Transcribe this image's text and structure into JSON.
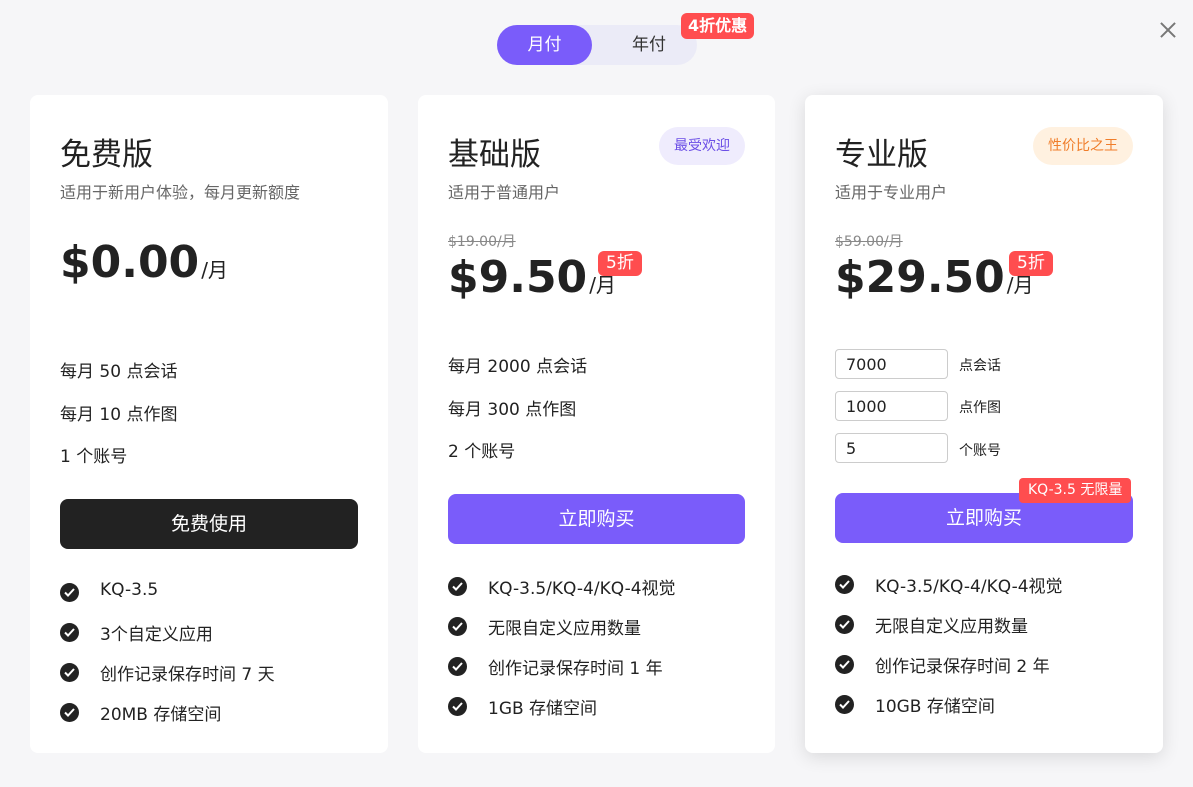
{
  "toggle": {
    "monthly": "月付",
    "yearly": "年付",
    "yearly_discount": "4折优惠"
  },
  "plans": {
    "free": {
      "title": "免费版",
      "subtitle": "适用于新用户体验，每月更新额度",
      "price": "$0.00",
      "unit": "/月",
      "quotas": [
        "每月 50 点会话",
        "每月 10 点作图",
        "1 个账号"
      ],
      "button": "免费使用",
      "features": [
        "KQ-3.5",
        "3个自定义应用",
        "创作记录保存时间 7 天",
        "20MB 存储空间"
      ]
    },
    "basic": {
      "title": "基础版",
      "badge": "最受欢迎",
      "subtitle": "适用于普通用户",
      "old_price": "$19.00/月",
      "price": "$9.50",
      "unit": "/月",
      "off": "5折",
      "quotas": [
        "每月 2000 点会话",
        "每月 300 点作图",
        "2 个账号"
      ],
      "button": "立即购买",
      "features": [
        " KQ-3.5/KQ-4/KQ-4视觉",
        "无限自定义应用数量",
        "创作记录保存时间 1 年",
        "1GB 存储空间"
      ]
    },
    "pro": {
      "title": "专业版",
      "badge": "性价比之王",
      "subtitle": "适用于专业用户",
      "old_price": "$59.00/月",
      "price": "$29.50",
      "unit": "/月",
      "off": "5折",
      "inputs": [
        {
          "value": "7000",
          "label": "点会话"
        },
        {
          "value": "1000",
          "label": "点作图"
        },
        {
          "value": "5",
          "label": "个账号"
        }
      ],
      "unlimited_tag": "KQ-3.5 无限量",
      "button": "立即购买",
      "features": [
        " KQ-3.5/KQ-4/KQ-4视觉",
        "无限自定义应用数量",
        "创作记录保存时间 2 年",
        "10GB 存储空间"
      ]
    }
  },
  "colors": {
    "accent": "#7a5cfa",
    "discount_red": "#ff4d4f",
    "dark_button": "#222222"
  },
  "icons": {
    "close": "close-icon",
    "check": "check-circle-icon"
  }
}
